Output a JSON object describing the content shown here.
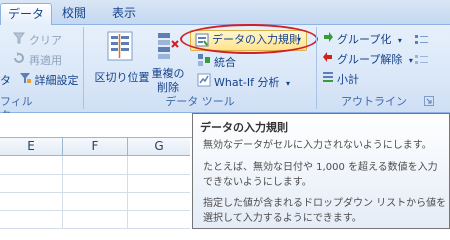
{
  "tabs": [
    "データ",
    "校閲",
    "表示"
  ],
  "left_group": {
    "clear": "クリア",
    "reapply": "再適用",
    "advanced": "詳細設定",
    "label_fragment": "フィルタ",
    "cut_char": "タ"
  },
  "data_tools": {
    "text_to_columns": "区切り位置",
    "remove_dup_line1": "重複の",
    "remove_dup_line2": "削除",
    "validation": "データの入力規則",
    "consolidate": "統合",
    "whatif": "What-If 分析",
    "label": "データ ツール"
  },
  "outline": {
    "group": "グループ化",
    "ungroup": "グループ解除",
    "subtotal": "小計",
    "label": "アウトライン"
  },
  "columns": [
    "E",
    "F",
    "G"
  ],
  "tooltip": {
    "title": "データの入力規則",
    "p1": "無効なデータがセルに入力されないようにします。",
    "p2": "たとえば、無効な日付や 1,000 を超える数値を入力できないようにします。",
    "p3": "指定した値が含まれるドロップダウン リストから値を選択して入力するようにできます。"
  },
  "colors": {
    "highlight_ring": "#d0202a",
    "ribbon": "#dbe8f8",
    "text": "#15428b"
  }
}
